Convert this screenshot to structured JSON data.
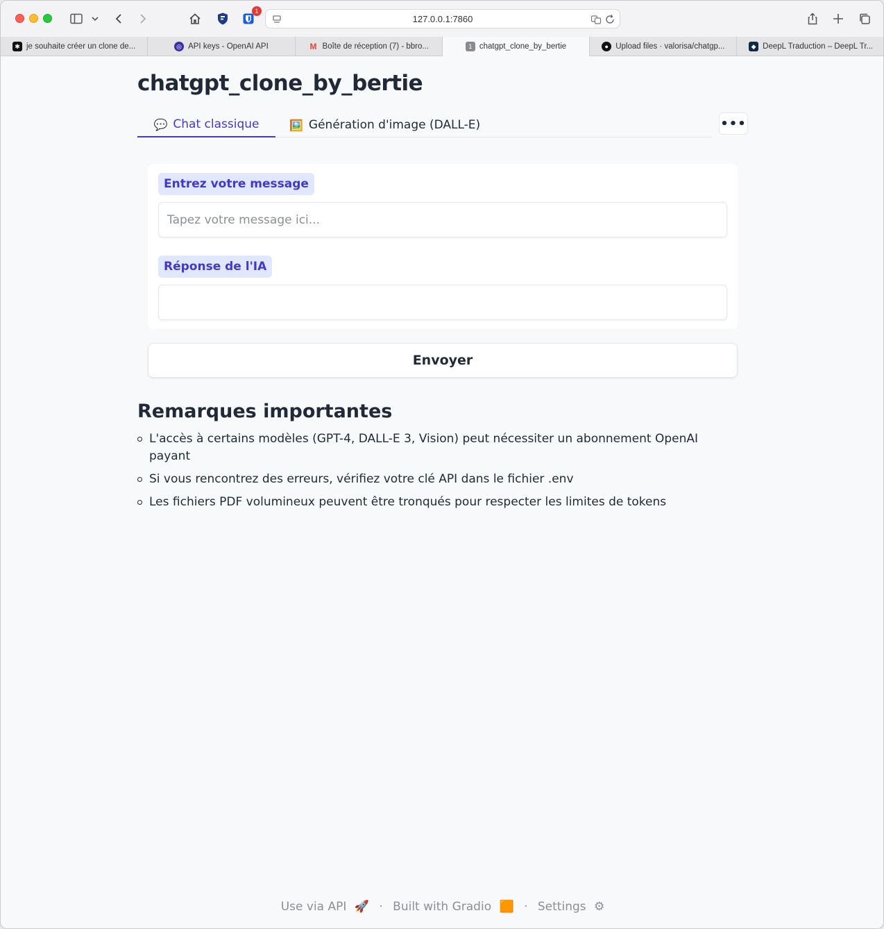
{
  "browser": {
    "url": "127.0.0.1:7860",
    "notification_badge": "1",
    "tabs": [
      {
        "label": "je souhaite créer un clone de..."
      },
      {
        "label": "API keys - OpenAI API"
      },
      {
        "label": "Boîte de réception (7) - bbro..."
      },
      {
        "label": "chatgpt_clone_by_bertie",
        "badge": "1"
      },
      {
        "label": "Upload files · valorisa/chatgp..."
      },
      {
        "label": "DeepL Traduction – DeepL Tr..."
      }
    ]
  },
  "app": {
    "title": "chatgpt_clone_by_bertie",
    "tabs": [
      {
        "emoji": "💬",
        "label": "Chat classique"
      },
      {
        "emoji": "🖼️",
        "label": "Génération d'image (DALL-E)"
      }
    ],
    "more_label": "•••"
  },
  "chat": {
    "input_label": "Entrez votre message",
    "input_placeholder": "Tapez votre message ici...",
    "input_value": "",
    "output_label": "Réponse de l'IA",
    "output_value": "",
    "send_label": "Envoyer"
  },
  "remarks": {
    "title": "Remarques importantes",
    "items": [
      "L'accès à certains modèles (GPT-4, DALL-E 3, Vision) peut nécessiter un abonnement OpenAI payant",
      "Si vous rencontrez des erreurs, vérifiez votre clé API dans le fichier .env",
      "Les fichiers PDF volumineux peuvent être tronqués pour respecter les limites de tokens"
    ]
  },
  "footer": {
    "api_label": "Use via API",
    "api_emoji": "🚀",
    "built_label": "Built with Gradio",
    "built_emoji": "🟧",
    "settings_label": "Settings",
    "settings_emoji": "⚙",
    "separator": "·"
  }
}
